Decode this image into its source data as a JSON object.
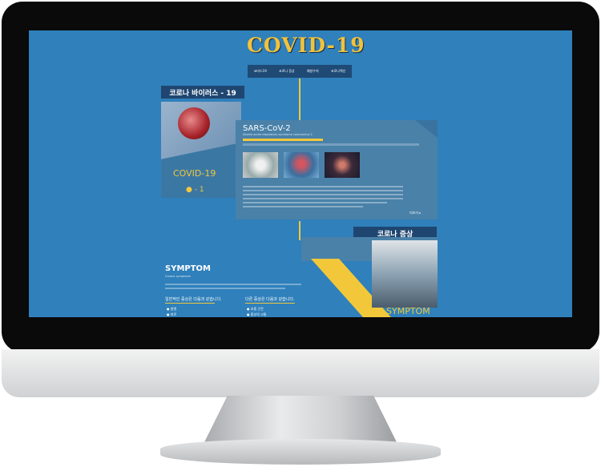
{
  "site": {
    "logo": "COVID-19",
    "nav": [
      "코비드19",
      "코로나 증상",
      "예방수칙",
      "코로나백신"
    ]
  },
  "left_card": {
    "header": "코로나 바이러스 - 19",
    "title": "COVID-19",
    "dot": "•",
    "number": "● - 1"
  },
  "info_panel": {
    "title": "SARS-CoV-2",
    "subtitle": "Severe acute respiratory syndrome coronavirus 2",
    "more": "더보기 ▸"
  },
  "symptom_header": "코로나 증상",
  "symptom": {
    "title": "SYMPTOM",
    "subtitle": "Corona symptoms",
    "col1_title": "일반적인 증상은 다음과 같습니다.",
    "col2_title": "다른 증상은 다음과 같습니다.",
    "col1_items": [
      "발열",
      "피로"
    ],
    "col2_items": [
      "호흡 곤란",
      "흉부의 고통"
    ],
    "right_title": "SYMPTOM"
  }
}
